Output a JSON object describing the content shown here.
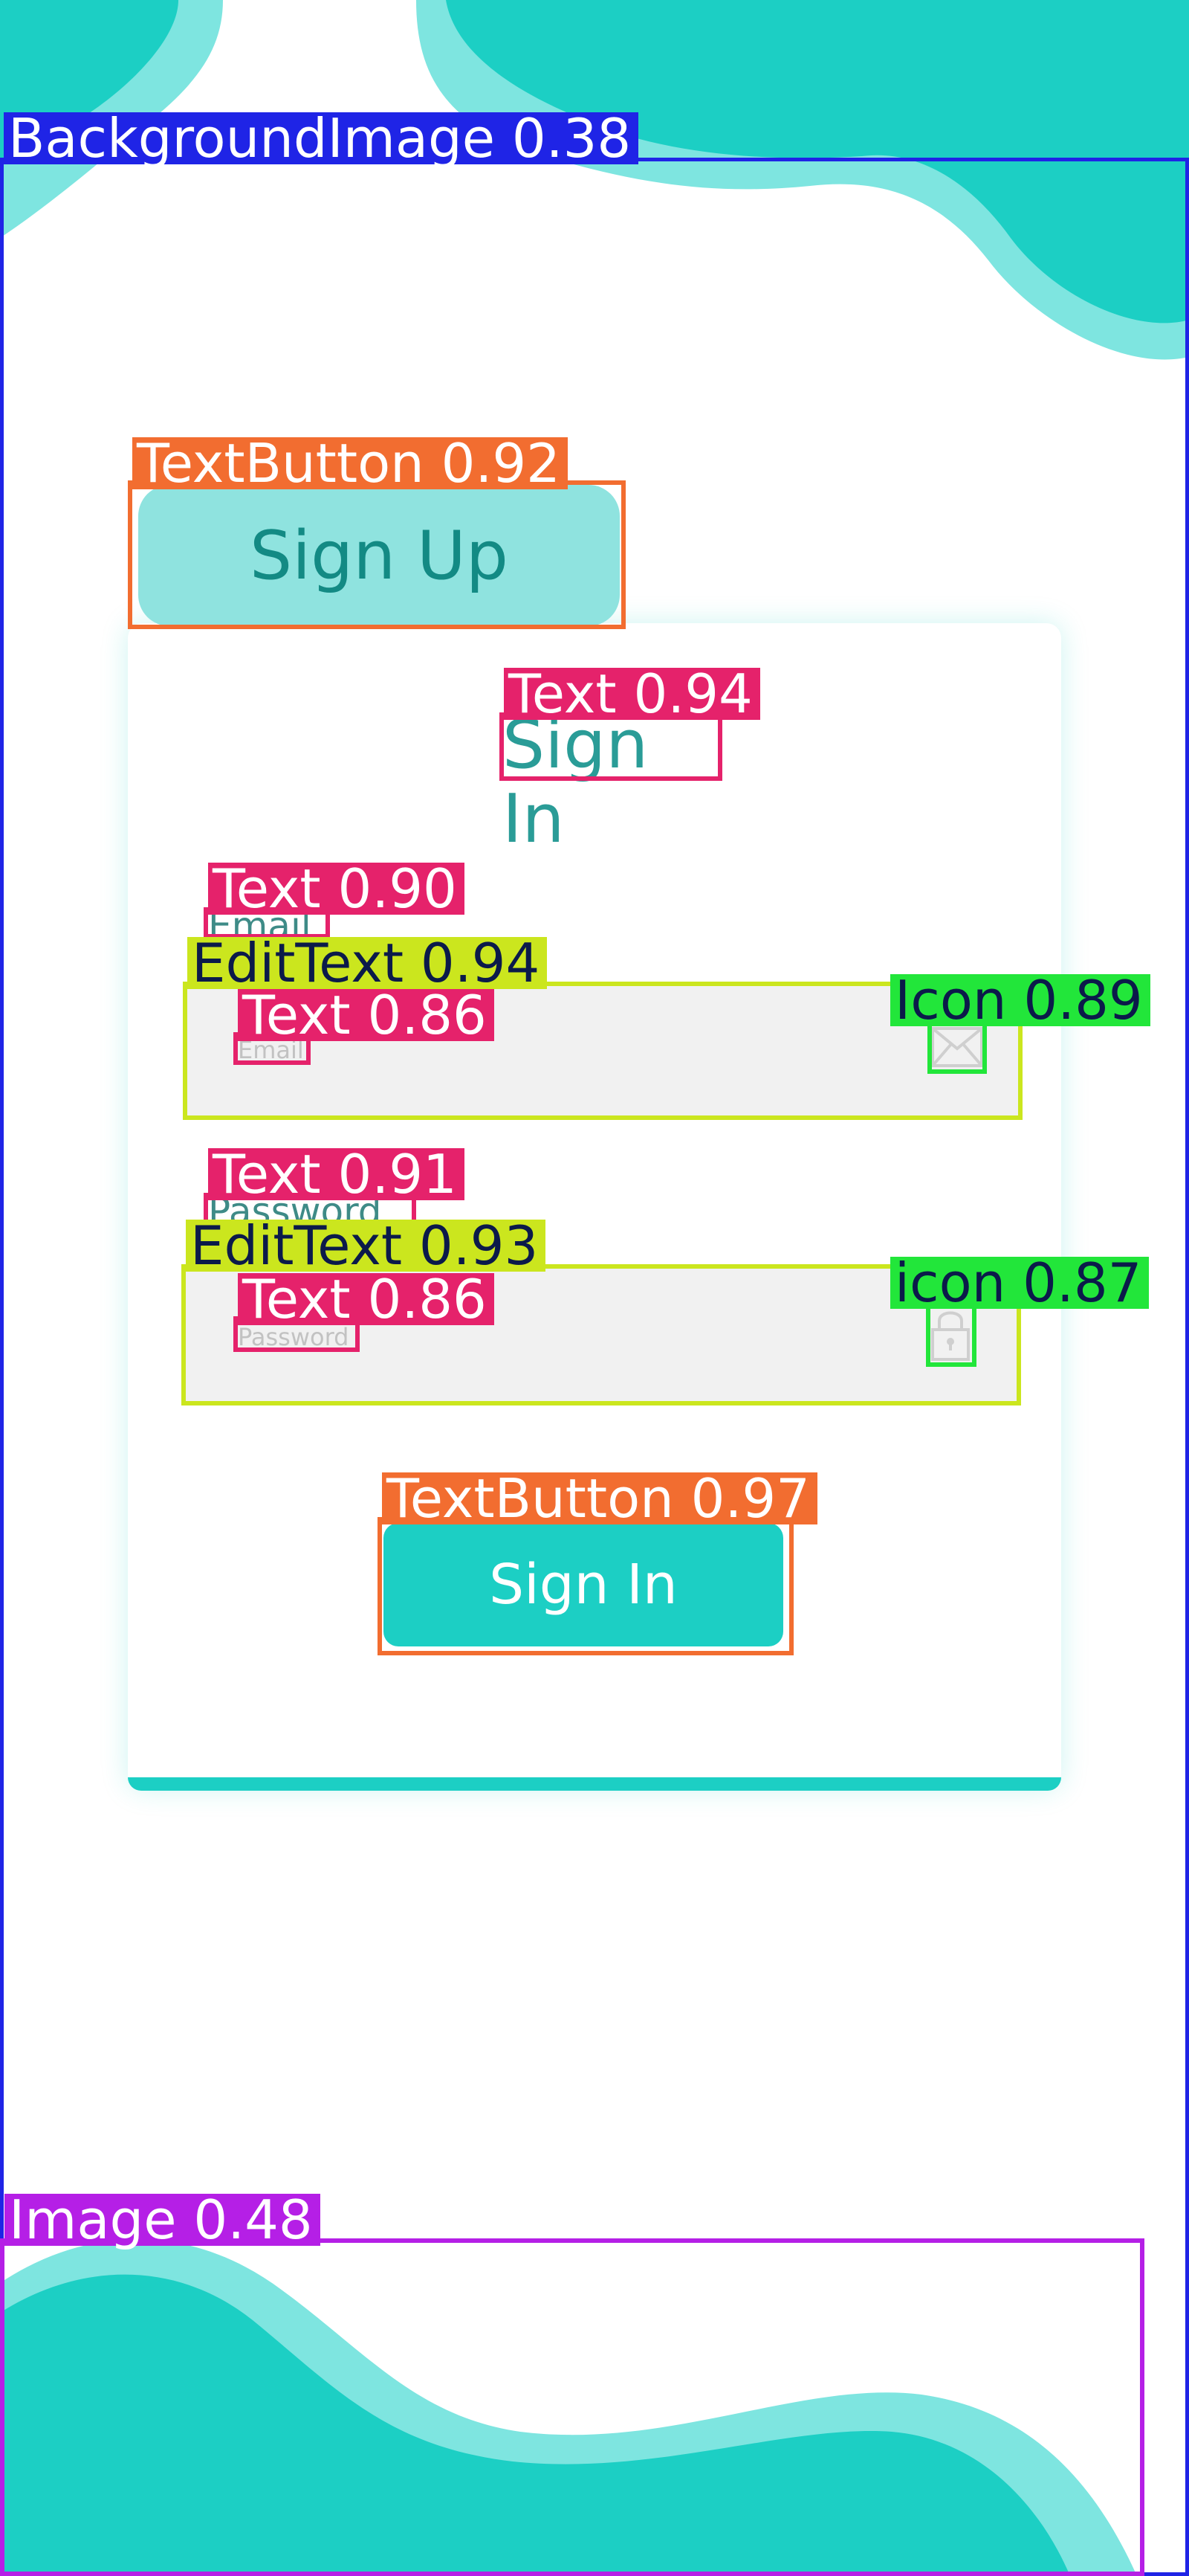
{
  "colors": {
    "accent": "#1ccfc4",
    "accent_light": "#8fe3df",
    "wave_light": "#7ee5e0",
    "label_text": "#3e8b87",
    "field_bg": "#f1f1f1",
    "placeholder": "#c2c2c2"
  },
  "signup": {
    "label": "Sign Up"
  },
  "form": {
    "title": "Sign In",
    "email": {
      "label": "Email",
      "placeholder": "Email",
      "icon": "envelope-icon"
    },
    "password": {
      "label": "Password",
      "placeholder": "Password",
      "icon": "lock-icon"
    },
    "submit_label": "Sign In"
  },
  "annotations": {
    "background_image": "BackgroundImage 0.38",
    "signup_button": "TextButton 0.92",
    "title_text": "Text 0.94",
    "email_label": "Text 0.90",
    "email_edit": "EditText 0.94",
    "email_placeholder": "Text 0.86",
    "email_icon": "Icon 0.89",
    "password_label": "Text 0.91",
    "password_edit": "EditText 0.93",
    "password_placeholder": "Text 0.86",
    "password_icon": "icon 0.87",
    "signin_button": "TextButton 0.97",
    "bottom_image": "Image 0.48"
  }
}
